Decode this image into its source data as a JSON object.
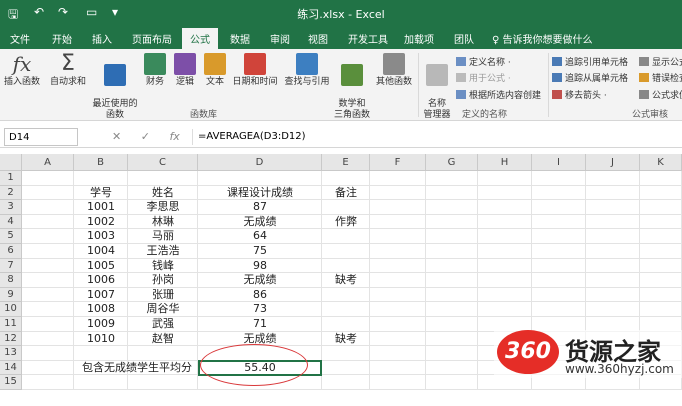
{
  "window": {
    "title": "练习.xlsx  -  Excel",
    "quick_access": [
      "save-icon",
      "undo-icon",
      "redo-icon",
      "print-icon",
      "dropdown-icon"
    ]
  },
  "tabs": [
    "文件",
    "开始",
    "插入",
    "页面布局",
    "公式",
    "数据",
    "审阅",
    "视图",
    "开发工具",
    "加载项",
    "团队"
  ],
  "active_tab": "公式",
  "tell_me": "告诉我你想要做什么",
  "ribbon": {
    "big_buttons": [
      "插入函数",
      "自动求和",
      "最近使用的\n函数",
      "财务",
      "逻辑",
      "文本",
      "日期和时间",
      "查找与引用",
      "数学和\n三角函数",
      "其他函数",
      "名称\n管理器"
    ],
    "group_function_library": "函数库",
    "group_defined_names": "定义的名称",
    "group_formula_auditing": "公式审核",
    "defined_names_items": [
      "定义名称 ·",
      "用于公式 ·",
      "根据所选内容创建"
    ],
    "auditing_items": [
      "追踪引用单元格",
      "追踪从属单元格",
      "移去箭头 ·",
      "显示公式",
      "错误检查",
      "公式求值"
    ]
  },
  "formula_bar": {
    "name_box": "D14",
    "formula": "=AVERAGEA(D3:D12)",
    "icons": [
      "✕",
      "✓",
      "fx"
    ]
  },
  "columns": [
    "A",
    "B",
    "C",
    "D",
    "E",
    "F",
    "G",
    "H",
    "I",
    "J",
    "K"
  ],
  "rows": [
    "1",
    "2",
    "3",
    "4",
    "5",
    "6",
    "7",
    "8",
    "9",
    "10",
    "11",
    "12",
    "13",
    "14",
    "15"
  ],
  "headers": {
    "id": "学号",
    "name": "姓名",
    "score": "课程设计成绩",
    "note": "备注"
  },
  "records": [
    {
      "id": "1001",
      "name": "李思思",
      "score": "87",
      "note": ""
    },
    {
      "id": "1002",
      "name": "林琳",
      "score": "无成绩",
      "note": "作弊"
    },
    {
      "id": "1003",
      "name": "马丽",
      "score": "64",
      "note": ""
    },
    {
      "id": "1004",
      "name": "王浩浩",
      "score": "75",
      "note": ""
    },
    {
      "id": "1005",
      "name": "钱峰",
      "score": "98",
      "note": ""
    },
    {
      "id": "1006",
      "name": "孙岗",
      "score": "无成绩",
      "note": "缺考"
    },
    {
      "id": "1007",
      "name": "张珊",
      "score": "86",
      "note": ""
    },
    {
      "id": "1008",
      "name": "周谷华",
      "score": "73",
      "note": ""
    },
    {
      "id": "1009",
      "name": "武强",
      "score": "71",
      "note": ""
    },
    {
      "id": "1010",
      "name": "赵智",
      "score": "无成绩",
      "note": "缺考"
    }
  ],
  "summary": {
    "label": "包含无成绩学生平均分",
    "value": "55.40"
  },
  "watermark": {
    "logo": "360",
    "text": "货源之家",
    "url": "www.360hyzj.com"
  },
  "colors": {
    "excel_green": "#217346",
    "annotation_red": "#d9383a",
    "watermark_red": "#e52d27"
  }
}
